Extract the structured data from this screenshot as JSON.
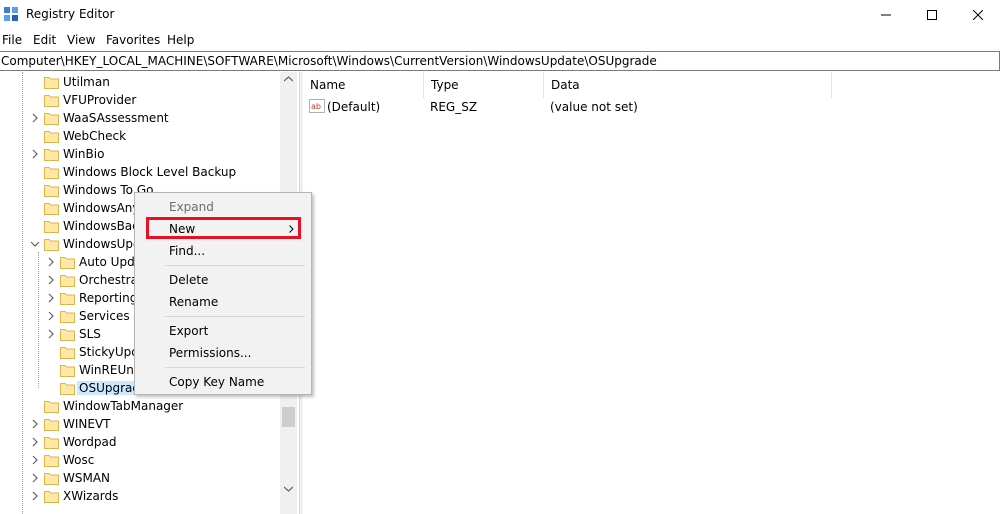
{
  "window": {
    "title": "Registry Editor"
  },
  "menu": [
    "File",
    "Edit",
    "View",
    "Favorites",
    "Help"
  ],
  "address": "Computer\\HKEY_LOCAL_MACHINE\\SOFTWARE\\Microsoft\\Windows\\CurrentVersion\\WindowsUpdate\\OSUpgrade",
  "tree": [
    {
      "label": "Utilman",
      "expandable": false,
      "level": 1
    },
    {
      "label": "VFUProvider",
      "expandable": false,
      "level": 1
    },
    {
      "label": "WaaSAssessment",
      "expandable": true,
      "level": 1
    },
    {
      "label": "WebCheck",
      "expandable": false,
      "level": 1
    },
    {
      "label": "WinBio",
      "expandable": true,
      "level": 1
    },
    {
      "label": "Windows Block Level Backup",
      "expandable": false,
      "level": 1
    },
    {
      "label": "Windows To Go",
      "expandable": false,
      "level": 1
    },
    {
      "label": "WindowsAny",
      "expandable": false,
      "level": 1
    },
    {
      "label": "WindowsBack",
      "expandable": false,
      "level": 1
    },
    {
      "label": "WindowsUpd",
      "expandable": true,
      "expanded": true,
      "level": 1
    },
    {
      "label": "Auto Upda",
      "expandable": true,
      "level": 2
    },
    {
      "label": "Orchestrat",
      "expandable": true,
      "level": 2
    },
    {
      "label": "Reporting",
      "expandable": true,
      "level": 2
    },
    {
      "label": "Services",
      "expandable": true,
      "level": 2
    },
    {
      "label": "SLS",
      "expandable": true,
      "level": 2
    },
    {
      "label": "StickyUpda",
      "expandable": false,
      "level": 2
    },
    {
      "label": "WinREUnin",
      "expandable": false,
      "level": 2
    },
    {
      "label": "OSUpgrad",
      "expandable": false,
      "level": 2,
      "selected": true
    },
    {
      "label": "WindowTabManager",
      "expandable": false,
      "level": 1
    },
    {
      "label": "WINEVT",
      "expandable": true,
      "level": 1
    },
    {
      "label": "Wordpad",
      "expandable": true,
      "level": 1
    },
    {
      "label": "Wosc",
      "expandable": true,
      "level": 1
    },
    {
      "label": "WSMAN",
      "expandable": true,
      "level": 1
    },
    {
      "label": "XWizards",
      "expandable": true,
      "level": 1
    }
  ],
  "list": {
    "columns": [
      "Name",
      "Type",
      "Data"
    ],
    "rows": [
      {
        "name": "(Default)",
        "type": "REG_SZ",
        "data": "(value not set)",
        "icon": "ab"
      }
    ]
  },
  "context_menu": {
    "items": [
      {
        "label": "Expand",
        "disabled": true
      },
      {
        "label": "New",
        "submenu": true,
        "highlighted": true
      },
      {
        "label": "Find..."
      },
      {
        "label": "Delete"
      },
      {
        "label": "Rename"
      },
      {
        "label": "Export"
      },
      {
        "label": "Permissions..."
      },
      {
        "label": "Copy Key Name"
      }
    ],
    "highlight_color": "#e81123"
  }
}
